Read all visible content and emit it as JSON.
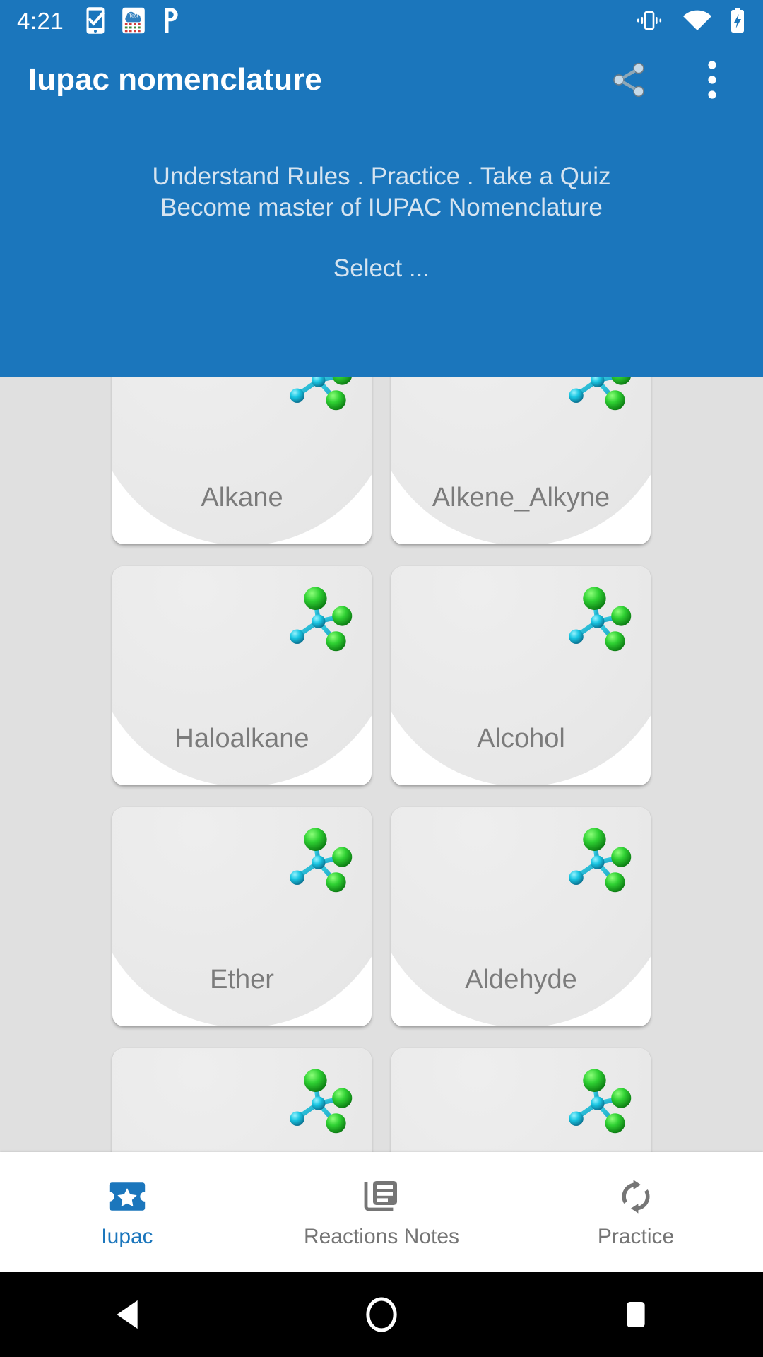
{
  "status_bar": {
    "time": "4:21",
    "left_icons": [
      "phone-check-notification-icon",
      "test-calendar-notification-icon",
      "p-parking-notification-icon"
    ],
    "right_icons": [
      "vibrate-icon",
      "wifi-icon",
      "battery-charging-icon"
    ]
  },
  "app_bar": {
    "title": "Iupac nomenclature",
    "share_icon": "share-icon",
    "overflow_icon": "more-vert-icon"
  },
  "headline": {
    "line1": "Understand Rules . Practice . Take a Quiz",
    "line2": "Become master of IUPAC Nomenclature",
    "select_prompt": "Select ..."
  },
  "grid": {
    "cards": [
      {
        "label": "Alkane",
        "icon": "molecule-icon"
      },
      {
        "label": "Alkene_Alkyne",
        "icon": "molecule-icon"
      },
      {
        "label": "Haloalkane",
        "icon": "molecule-icon"
      },
      {
        "label": "Alcohol",
        "icon": "molecule-icon"
      },
      {
        "label": "Ether",
        "icon": "molecule-icon"
      },
      {
        "label": "Aldehyde",
        "icon": "molecule-icon"
      },
      {
        "label": "",
        "icon": "molecule-icon"
      },
      {
        "label": "",
        "icon": "molecule-icon"
      }
    ]
  },
  "bottom_nav": {
    "items": [
      {
        "label": "Iupac",
        "icon": "ticket-star-icon",
        "active": true
      },
      {
        "label": "Reactions Notes",
        "icon": "article-icon",
        "active": false
      },
      {
        "label": "Practice",
        "icon": "sync-refresh-icon",
        "active": false
      }
    ]
  },
  "system_nav": {
    "back": "back-triangle-icon",
    "home": "home-circle-icon",
    "recents": "recents-square-icon"
  },
  "colors": {
    "primary_blue": "#1b76bc",
    "body_grey": "#e0e0e0",
    "card_white": "#ffffff",
    "label_grey": "#7b7b7b",
    "headline_text": "#d6e4f0",
    "molecule_green": "#22c425",
    "molecule_cyan": "#22c8e0"
  }
}
